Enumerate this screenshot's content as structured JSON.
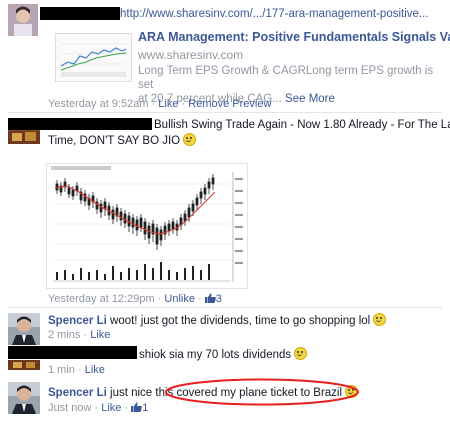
{
  "post1": {
    "url": "http://www.sharesinv.com/.../177-ara-management-positive...",
    "card_title": "ARA Management: Positive Fundamentals Signals Value",
    "card_domain": "www.sharesinv.com",
    "card_desc_line1": "Long Term EPS Growth & CAGRLong term EPS growth is set",
    "card_desc_line2": "at 20.7 percent while CAG...",
    "see_more": "See More",
    "time": "Yesterday at 9:52am",
    "like": "Like",
    "remove_preview": "Remove Preview"
  },
  "post2": {
    "text_line1": "Bullish Swing Trade Again - Now 1.80 Already - For The Last",
    "text_line2": "Time, DON'T SAY BO JIO",
    "time": "Yesterday at 12:29pm",
    "unlike": "Unlike",
    "like_count": "3"
  },
  "comments": [
    {
      "name": "Spencer Li",
      "text": "woot! just got the dividends, time to go shopping lol",
      "time": "2 mins",
      "like": "Like"
    },
    {
      "name": "",
      "text": "shiok sia my 70 lots dividends",
      "time": "1 min",
      "like": "Like"
    },
    {
      "name": "Spencer Li",
      "text_before": "just nice this ",
      "text_circled": "covered my plane ticket to Brazil",
      "time": "Just now",
      "like": "Like",
      "like_count": "1"
    }
  ],
  "separator": "·",
  "colors": {
    "link": "#3b5998",
    "meta": "#9197a3",
    "annotation": "#e8201c"
  }
}
